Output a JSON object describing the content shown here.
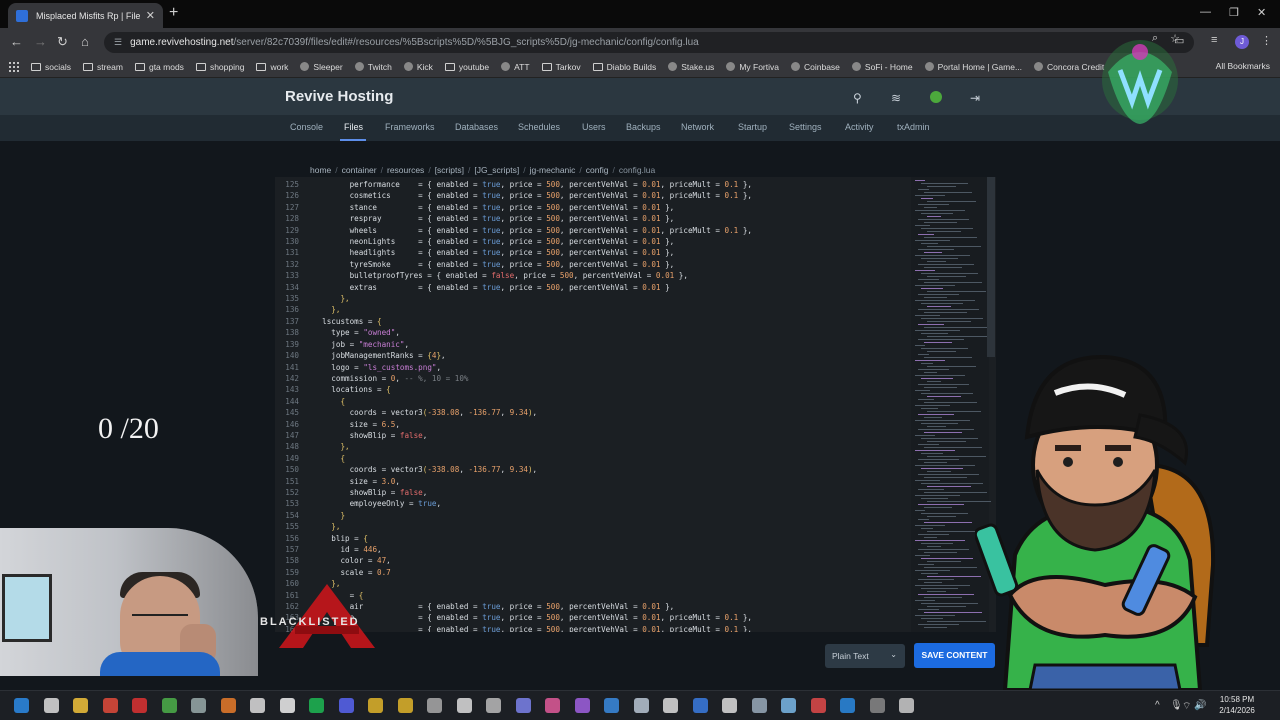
{
  "browser": {
    "tab_title": "Misplaced Misfits Rp | File Man",
    "url_host": "game.revivehosting.net",
    "url_path": "/server/82c7039f/files/edit#/resources/%5Bscripts%5D/%5BJG_scripts%5D/jg-mechanic/config/config.lua",
    "profile_initial": "J",
    "bookmarks": [
      "socials",
      "stream",
      "gta mods",
      "shopping",
      "work",
      "Sleeper",
      "Twitch",
      "Kick",
      "youtube",
      "ATT",
      "Tarkov",
      "Diablo Builds",
      "Stake.us",
      "My Fortiva",
      "Coinbase",
      "SoFi - Home",
      "Portal Home | Game...",
      "Concora Credit"
    ],
    "all_bookmarks": "All Bookmarks"
  },
  "panel": {
    "brand": "Revive Hosting",
    "nav": [
      "Console",
      "Files",
      "Frameworks",
      "Databases",
      "Schedules",
      "Users",
      "Backups",
      "Network",
      "Startup",
      "Settings",
      "Activity",
      "txAdmin"
    ],
    "active_nav": "Files"
  },
  "breadcrumb": [
    "home",
    "container",
    "resources",
    "[scripts]",
    "[JG_scripts]",
    "jg-mechanic",
    "config",
    "config.lua"
  ],
  "editor": {
    "lines": [
      {
        "n": "125",
        "ind": 4,
        "tokens": [
          [
            "k",
            "performance"
          ],
          [
            "p",
            "    = { "
          ],
          [
            "k",
            "enabled"
          ],
          [
            "p",
            " = "
          ],
          [
            "t",
            "true"
          ],
          [
            "p",
            ", price = "
          ],
          [
            "n",
            "500"
          ],
          [
            "p",
            ", percentVehVal = "
          ],
          [
            "n",
            "0.01"
          ],
          [
            "p",
            ", priceMult = "
          ],
          [
            "n",
            "0.1"
          ],
          [
            "p",
            " },"
          ]
        ]
      },
      {
        "n": "126",
        "ind": 4,
        "tokens": [
          [
            "k",
            "cosmetics"
          ],
          [
            "p",
            "      = { "
          ],
          [
            "k",
            "enabled"
          ],
          [
            "p",
            " = "
          ],
          [
            "t",
            "true"
          ],
          [
            "p",
            ", price = "
          ],
          [
            "n",
            "500"
          ],
          [
            "p",
            ", percentVehVal = "
          ],
          [
            "n",
            "0.01"
          ],
          [
            "p",
            ", priceMult = "
          ],
          [
            "n",
            "0.1"
          ],
          [
            "p",
            " },"
          ]
        ]
      },
      {
        "n": "127",
        "ind": 4,
        "tokens": [
          [
            "k",
            "stance"
          ],
          [
            "p",
            "         = { "
          ],
          [
            "k",
            "enabled"
          ],
          [
            "p",
            " = "
          ],
          [
            "t",
            "true"
          ],
          [
            "p",
            ", price = "
          ],
          [
            "n",
            "500"
          ],
          [
            "p",
            ", percentVehVal = "
          ],
          [
            "n",
            "0.01"
          ],
          [
            "p",
            " },"
          ]
        ]
      },
      {
        "n": "128",
        "ind": 4,
        "tokens": [
          [
            "k",
            "respray"
          ],
          [
            "p",
            "        = { "
          ],
          [
            "k",
            "enabled"
          ],
          [
            "p",
            " = "
          ],
          [
            "t",
            "true"
          ],
          [
            "p",
            ", price = "
          ],
          [
            "n",
            "500"
          ],
          [
            "p",
            ", percentVehVal = "
          ],
          [
            "n",
            "0.01"
          ],
          [
            "p",
            " },"
          ]
        ]
      },
      {
        "n": "129",
        "ind": 4,
        "tokens": [
          [
            "k",
            "wheels"
          ],
          [
            "p",
            "         = { "
          ],
          [
            "k",
            "enabled"
          ],
          [
            "p",
            " = "
          ],
          [
            "t",
            "true"
          ],
          [
            "p",
            ", price = "
          ],
          [
            "n",
            "500"
          ],
          [
            "p",
            ", percentVehVal = "
          ],
          [
            "n",
            "0.01"
          ],
          [
            "p",
            ", priceMult = "
          ],
          [
            "n",
            "0.1"
          ],
          [
            "p",
            " },"
          ]
        ]
      },
      {
        "n": "130",
        "ind": 4,
        "tokens": [
          [
            "k",
            "neonLights"
          ],
          [
            "p",
            "     = { "
          ],
          [
            "k",
            "enabled"
          ],
          [
            "p",
            " = "
          ],
          [
            "t",
            "true"
          ],
          [
            "p",
            ", price = "
          ],
          [
            "n",
            "500"
          ],
          [
            "p",
            ", percentVehVal = "
          ],
          [
            "n",
            "0.01"
          ],
          [
            "p",
            " },"
          ]
        ]
      },
      {
        "n": "131",
        "ind": 4,
        "tokens": [
          [
            "k",
            "headlights"
          ],
          [
            "p",
            "     = { "
          ],
          [
            "k",
            "enabled"
          ],
          [
            "p",
            " = "
          ],
          [
            "t",
            "true"
          ],
          [
            "p",
            ", price = "
          ],
          [
            "n",
            "500"
          ],
          [
            "p",
            ", percentVehVal = "
          ],
          [
            "n",
            "0.01"
          ],
          [
            "p",
            " },"
          ]
        ]
      },
      {
        "n": "132",
        "ind": 4,
        "tokens": [
          [
            "k",
            "tyreSmoke"
          ],
          [
            "p",
            "      = { "
          ],
          [
            "k",
            "enabled"
          ],
          [
            "p",
            " = "
          ],
          [
            "t",
            "true"
          ],
          [
            "p",
            ", price = "
          ],
          [
            "n",
            "500"
          ],
          [
            "p",
            ", percentVehVal = "
          ],
          [
            "n",
            "0.01"
          ],
          [
            "p",
            " },"
          ]
        ]
      },
      {
        "n": "133",
        "ind": 4,
        "tokens": [
          [
            "k",
            "bulletproofTyres"
          ],
          [
            "p",
            " = { "
          ],
          [
            "k",
            "enabled"
          ],
          [
            "p",
            " = "
          ],
          [
            "f",
            "false"
          ],
          [
            "p",
            ", price = "
          ],
          [
            "n",
            "500"
          ],
          [
            "p",
            ", percentVehVal = "
          ],
          [
            "n",
            "0.01"
          ],
          [
            "p",
            " },"
          ]
        ]
      },
      {
        "n": "134",
        "ind": 4,
        "tokens": [
          [
            "k",
            "extras"
          ],
          [
            "p",
            "         = { "
          ],
          [
            "k",
            "enabled"
          ],
          [
            "p",
            " = "
          ],
          [
            "t",
            "true"
          ],
          [
            "p",
            ", price = "
          ],
          [
            "n",
            "500"
          ],
          [
            "p",
            ", percentVehVal = "
          ],
          [
            "n",
            "0.01"
          ],
          [
            "p",
            " }"
          ]
        ]
      },
      {
        "n": "135",
        "ind": 3,
        "tokens": [
          [
            "b",
            "},"
          ]
        ]
      },
      {
        "n": "136",
        "ind": 2,
        "tokens": [
          [
            "b",
            "},"
          ]
        ]
      },
      {
        "n": "137",
        "ind": 1,
        "tokens": [
          [
            "k",
            "lscustoms"
          ],
          [
            "p",
            " = "
          ],
          [
            "b",
            "{"
          ]
        ]
      },
      {
        "n": "138",
        "ind": 2,
        "tokens": [
          [
            "k",
            "type"
          ],
          [
            "p",
            " = "
          ],
          [
            "s",
            "\"owned\""
          ],
          [
            "p",
            ","
          ]
        ]
      },
      {
        "n": "139",
        "ind": 2,
        "tokens": [
          [
            "k",
            "job"
          ],
          [
            "p",
            " = "
          ],
          [
            "s",
            "\"mechanic\""
          ],
          [
            "p",
            ","
          ]
        ]
      },
      {
        "n": "140",
        "ind": 2,
        "tokens": [
          [
            "k",
            "jobManagementRanks"
          ],
          [
            "p",
            " = "
          ],
          [
            "b",
            "{"
          ],
          [
            "n",
            "4"
          ],
          [
            "b",
            "}"
          ],
          [
            "p",
            ","
          ]
        ]
      },
      {
        "n": "141",
        "ind": 2,
        "tokens": [
          [
            "k",
            "logo"
          ],
          [
            "p",
            " = "
          ],
          [
            "s",
            "\"ls_customs.png\""
          ],
          [
            "p",
            ","
          ]
        ]
      },
      {
        "n": "142",
        "ind": 2,
        "tokens": [
          [
            "k",
            "commission"
          ],
          [
            "p",
            " = "
          ],
          [
            "n",
            "0"
          ],
          [
            "p",
            ", "
          ],
          [
            "c",
            "-- %, 10 = 10%"
          ]
        ]
      },
      {
        "n": "143",
        "ind": 2,
        "tokens": [
          [
            "k",
            "locations"
          ],
          [
            "p",
            " = "
          ],
          [
            "b",
            "{"
          ]
        ]
      },
      {
        "n": "144",
        "ind": 3,
        "tokens": [
          [
            "b",
            "{"
          ]
        ]
      },
      {
        "n": "145",
        "ind": 4,
        "tokens": [
          [
            "k",
            "coords"
          ],
          [
            "p",
            " = "
          ],
          [
            "k",
            "vector3"
          ],
          [
            "b",
            "("
          ],
          [
            "n",
            "-338.08"
          ],
          [
            "p",
            ", "
          ],
          [
            "n",
            "-136.77"
          ],
          [
            "p",
            ", "
          ],
          [
            "n",
            "9.34"
          ],
          [
            "b",
            ")"
          ],
          [
            "p",
            ","
          ]
        ]
      },
      {
        "n": "146",
        "ind": 4,
        "tokens": [
          [
            "k",
            "size"
          ],
          [
            "p",
            " = "
          ],
          [
            "n",
            "6.5"
          ],
          [
            "p",
            ","
          ]
        ]
      },
      {
        "n": "147",
        "ind": 4,
        "tokens": [
          [
            "k",
            "showBlip"
          ],
          [
            "p",
            " = "
          ],
          [
            "f",
            "false"
          ],
          [
            "p",
            ","
          ]
        ]
      },
      {
        "n": "148",
        "ind": 3,
        "tokens": [
          [
            "b",
            "},"
          ]
        ]
      },
      {
        "n": "149",
        "ind": 3,
        "tokens": [
          [
            "b",
            "{"
          ]
        ]
      },
      {
        "n": "150",
        "ind": 4,
        "tokens": [
          [
            "k",
            "coords"
          ],
          [
            "p",
            " = "
          ],
          [
            "k",
            "vector3"
          ],
          [
            "b",
            "("
          ],
          [
            "n",
            "-338.08"
          ],
          [
            "p",
            ", "
          ],
          [
            "n",
            "-136.77"
          ],
          [
            "p",
            ", "
          ],
          [
            "n",
            "9.34"
          ],
          [
            "b",
            ")"
          ],
          [
            "p",
            ","
          ]
        ]
      },
      {
        "n": "151",
        "ind": 4,
        "tokens": [
          [
            "k",
            "size"
          ],
          [
            "p",
            " = "
          ],
          [
            "n",
            "3.0"
          ],
          [
            "p",
            ","
          ]
        ]
      },
      {
        "n": "152",
        "ind": 4,
        "tokens": [
          [
            "k",
            "showBlip"
          ],
          [
            "p",
            " = "
          ],
          [
            "f",
            "false"
          ],
          [
            "p",
            ","
          ]
        ]
      },
      {
        "n": "153",
        "ind": 4,
        "tokens": [
          [
            "k",
            "employeeOnly"
          ],
          [
            "p",
            " = "
          ],
          [
            "t",
            "true"
          ],
          [
            "p",
            ","
          ]
        ]
      },
      {
        "n": "154",
        "ind": 3,
        "tokens": [
          [
            "b",
            "}"
          ]
        ]
      },
      {
        "n": "155",
        "ind": 2,
        "tokens": [
          [
            "b",
            "},"
          ]
        ]
      },
      {
        "n": "156",
        "ind": 2,
        "tokens": [
          [
            "k",
            "blip"
          ],
          [
            "p",
            " = "
          ],
          [
            "b",
            "{"
          ]
        ]
      },
      {
        "n": "157",
        "ind": 3,
        "tokens": [
          [
            "k",
            "id"
          ],
          [
            "p",
            " = "
          ],
          [
            "n",
            "446"
          ],
          [
            "p",
            ","
          ]
        ]
      },
      {
        "n": "158",
        "ind": 3,
        "tokens": [
          [
            "k",
            "color"
          ],
          [
            "p",
            " = "
          ],
          [
            "n",
            "47"
          ],
          [
            "p",
            ","
          ]
        ]
      },
      {
        "n": "159",
        "ind": 3,
        "tokens": [
          [
            "k",
            "scale"
          ],
          [
            "p",
            " = "
          ],
          [
            "n",
            "0.7"
          ]
        ]
      },
      {
        "n": "160",
        "ind": 2,
        "tokens": [
          [
            "b",
            "},"
          ]
        ]
      },
      {
        "n": "161",
        "ind": 2,
        "tokens": [
          [
            "p",
            "    = "
          ],
          [
            "b",
            "{"
          ]
        ]
      },
      {
        "n": "162",
        "ind": 4,
        "tokens": [
          [
            "k",
            "air"
          ],
          [
            "p",
            "            = { "
          ],
          [
            "k",
            "enabled"
          ],
          [
            "p",
            " = "
          ],
          [
            "t",
            "true"
          ],
          [
            "p",
            ", price = "
          ],
          [
            "n",
            "500"
          ],
          [
            "p",
            ", percentVehVal = "
          ],
          [
            "n",
            "0.01"
          ],
          [
            "p",
            " },"
          ]
        ]
      },
      {
        "n": "163",
        "ind": 4,
        "tokens": [
          [
            "k",
            "e"
          ],
          [
            "p",
            "              = { "
          ],
          [
            "k",
            "enabled"
          ],
          [
            "p",
            " = "
          ],
          [
            "t",
            "true"
          ],
          [
            "p",
            ", price = "
          ],
          [
            "n",
            "500"
          ],
          [
            "p",
            ", percentVehVal = "
          ],
          [
            "n",
            "0.01"
          ],
          [
            "p",
            ", priceMult = "
          ],
          [
            "n",
            "0.1"
          ],
          [
            "p",
            " },"
          ]
        ]
      },
      {
        "n": "164",
        "ind": 4,
        "tokens": [
          [
            "k",
            "e"
          ],
          [
            "p",
            "              = { "
          ],
          [
            "k",
            "enabled"
          ],
          [
            "p",
            " = "
          ],
          [
            "t",
            "true"
          ],
          [
            "p",
            ", price = "
          ],
          [
            "n",
            "500"
          ],
          [
            "p",
            ", percentVehVal = "
          ],
          [
            "n",
            "0.01"
          ],
          [
            "p",
            ", priceMult = "
          ],
          [
            "n",
            "0.1"
          ],
          [
            "p",
            " },"
          ]
        ]
      }
    ]
  },
  "controls": {
    "mode": "Plain Text",
    "save_label": "SAVE CONTENT"
  },
  "overlay": {
    "counter": "0 /20",
    "brand_text": "BLACKLISTED"
  },
  "taskbar": {
    "time": "10:58 PM",
    "date": "2/14/2026"
  }
}
